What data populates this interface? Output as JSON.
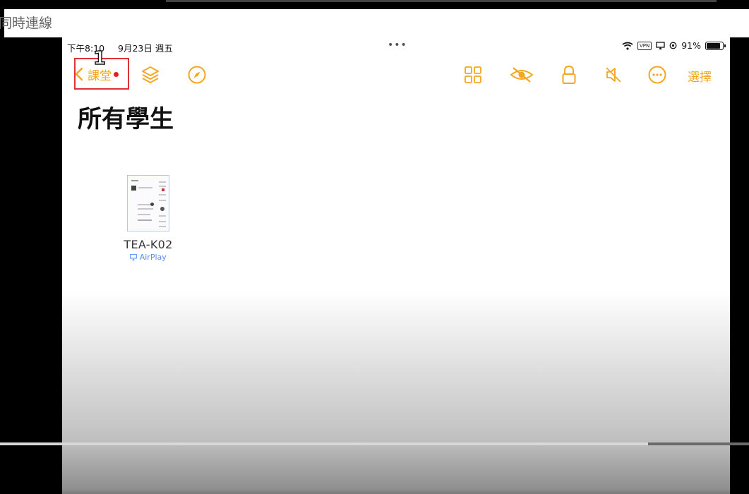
{
  "caption": {
    "text": "同時連線"
  },
  "status_bar": {
    "time": "下午8:10",
    "date": "9月23日 週五",
    "dots": "•••",
    "vpn": "VPN",
    "battery": "91%"
  },
  "toolbar": {
    "back_label": "課堂",
    "step_number": "1",
    "select_label": "選擇",
    "icons": [
      "chevron-left-icon",
      "layers-icon",
      "compass-icon",
      "grid-icon",
      "eye-slash-icon",
      "lock-icon",
      "mute-icon",
      "more-icon"
    ]
  },
  "page": {
    "title": "所有學生"
  },
  "students": [
    {
      "name": "TEA-K02",
      "status": "AirPlay"
    }
  ],
  "video": {
    "progress": 0.865
  },
  "colors": {
    "accent": "#f5a623",
    "highlight_box": "#e0313a",
    "airplay": "#5a8ff0"
  }
}
